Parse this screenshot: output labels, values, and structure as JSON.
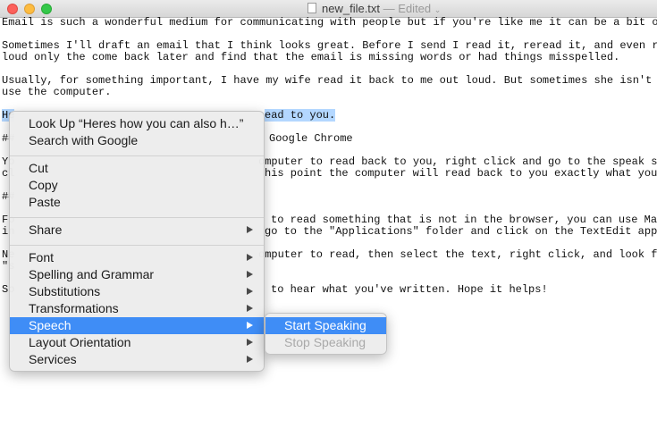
{
  "window": {
    "title": "new_file.txt",
    "status": "— Edited"
  },
  "editor": {
    "lines": [
      "Email is such a wonderful medium for communicating with people but if you're like me it can be a bit of a",
      "",
      "Sometimes I'll draft an email that I think looks great. Before I send I read it, reread it, and even read",
      "loud only the come back later and find that the email is missing words or had things misspelled.",
      "",
      "Usually, for something important, I have my wife read it back to me out loud. But sometimes she isn't aro",
      "use the computer.",
      "",
      "He",
      "",
      "##",
      "",
      "Yo",
      "cl",
      "",
      "##",
      "",
      "Fo",
      "in",
      "",
      "Ne",
      "\"s",
      "",
      "So"
    ],
    "line8_selected_tail": "ead to you.",
    "fragments": [
      "Google Chrome",
      "omputer to read back to you, right click and go to the speak se",
      "his point the computer will read back to you exactly what you'v",
      "to read something that is not in the browser, you can use MacO",
      "go to the \"Applications\" folder and click on the TextEdit appli",
      "omputer to read, then select the text, right click, and look fo",
      "to hear what you've written. Hope it helps!"
    ]
  },
  "context_menu": {
    "look_up": "Look Up “Heres how you can also h…”",
    "search": "Search with Google",
    "cut": "Cut",
    "copy": "Copy",
    "paste": "Paste",
    "share": "Share",
    "font": "Font",
    "spelling": "Spelling and Grammar",
    "substitutions": "Substitutions",
    "transformations": "Transformations",
    "speech": "Speech",
    "layout": "Layout Orientation",
    "services": "Services"
  },
  "speech_submenu": {
    "start": "Start Speaking",
    "stop": "Stop Speaking"
  },
  "colors": {
    "highlight": "#3f8df6",
    "selection": "#b3d7ff"
  }
}
